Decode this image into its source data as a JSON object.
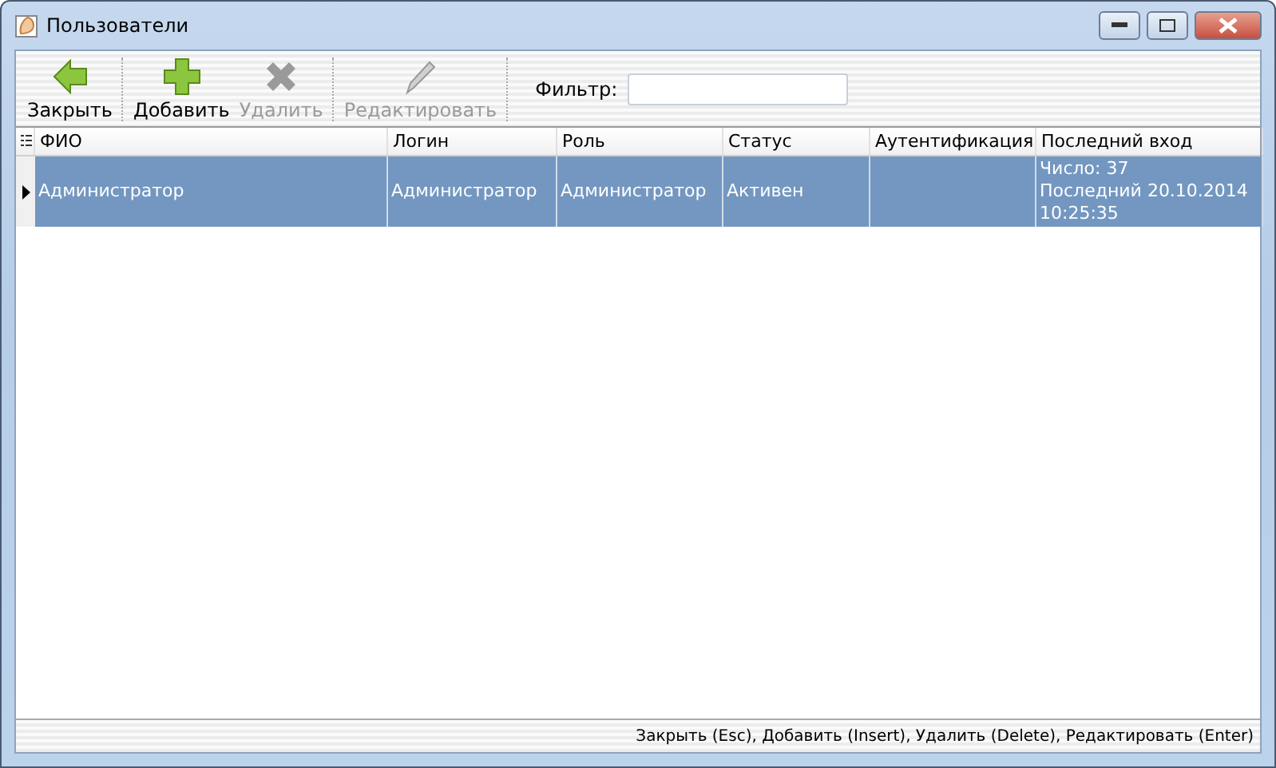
{
  "window": {
    "title": "Пользователи"
  },
  "toolbar": {
    "buttons": [
      {
        "kind": "close",
        "label": "Закрыть",
        "disabled": false
      },
      {
        "kind": "add",
        "label": "Добавить",
        "disabled": false
      },
      {
        "kind": "delete",
        "label": "Удалить",
        "disabled": true
      },
      {
        "kind": "edit",
        "label": "Редактировать",
        "disabled": true
      }
    ],
    "filter": {
      "label": "Фильтр:"
    }
  },
  "table": {
    "columns": [
      "ФИО",
      "Логин",
      "Роль",
      "Статус",
      "Аутентификация",
      "Последний вход"
    ],
    "rows": [
      {
        "selected": true,
        "cells": [
          "Администратор",
          "Администратор",
          "Администратор",
          "Активен",
          "",
          "Число: 37\nПоследний 20.10.2014\n10:25:35"
        ]
      }
    ]
  },
  "status_bar": "Закрыть (Esc), Добавить (Insert), Удалить (Delete), Редактировать (Enter)"
}
